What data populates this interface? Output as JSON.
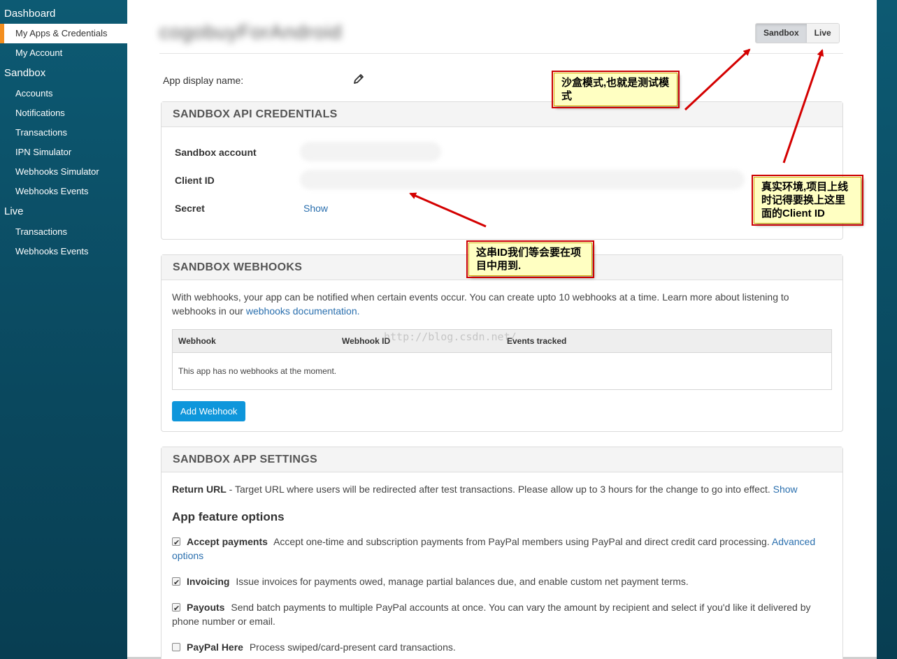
{
  "sidebar": {
    "groups": [
      {
        "label": "Dashboard",
        "items": [
          {
            "label": "My Apps & Credentials",
            "active": true
          },
          {
            "label": "My Account"
          }
        ]
      },
      {
        "label": "Sandbox",
        "items": [
          {
            "label": "Accounts"
          },
          {
            "label": "Notifications"
          },
          {
            "label": "Transactions"
          },
          {
            "label": "IPN Simulator"
          },
          {
            "label": "Webhooks Simulator"
          },
          {
            "label": "Webhooks Events"
          }
        ]
      },
      {
        "label": "Live",
        "items": [
          {
            "label": "Transactions"
          },
          {
            "label": "Webhooks Events"
          }
        ]
      }
    ]
  },
  "header": {
    "app_name": "cogobuyForAndroid",
    "env_toggle": {
      "sandbox": "Sandbox",
      "live": "Live",
      "selected": "Sandbox"
    }
  },
  "app_display_name_label": "App display name:",
  "credentials": {
    "title": "SANDBOX API CREDENTIALS",
    "sandbox_account_label": "Sandbox account",
    "client_id_label": "Client ID",
    "secret_label": "Secret",
    "secret_action": "Show"
  },
  "webhooks": {
    "title": "SANDBOX WEBHOOKS",
    "description": "With webhooks, your app can be notified when certain events occur. You can create upto 10 webhooks at a time. Learn more about listening to webhooks in our ",
    "doc_link": "webhooks documentation.",
    "columns": [
      "Webhook",
      "Webhook ID",
      "Events tracked"
    ],
    "empty_message": "This app has no webhooks at the moment.",
    "add_button": "Add Webhook",
    "watermark": "http://blog.csdn.net/"
  },
  "app_settings": {
    "title": "SANDBOX APP SETTINGS",
    "return_url_label": "Return URL",
    "return_url_text": " - Target URL where users will be redirected after test transactions. Please allow up to 3 hours for the change to go into effect. ",
    "return_url_action": "Show",
    "features_heading": "App feature options",
    "features": [
      {
        "name": "Accept payments",
        "desc": "Accept one-time and subscription payments from PayPal members using PayPal and direct credit card processing. ",
        "link": "Advanced options",
        "checked": true
      },
      {
        "name": "Invoicing",
        "desc": "Issue invoices for payments owed, manage partial balances due, and enable custom net payment terms.",
        "checked": true
      },
      {
        "name": "Payouts",
        "desc": "Send batch payments to multiple PayPal accounts at once. You can vary the amount by recipient and select if you'd like it delivered by phone number or email.",
        "checked": true
      },
      {
        "name": "PayPal Here",
        "desc": "Process swiped/card-present card transactions.",
        "checked": false
      }
    ]
  },
  "annotations": {
    "sandbox_note": "沙盒模式,也就是测试模式",
    "client_id_note": "这串ID我们等会要在项目中用到.",
    "live_note": "真实环境,项目上线时记得要换上这里面的Client ID"
  },
  "colors": {
    "sidebar_bg": "#0b4c63",
    "active_marker": "#f38e1e",
    "link": "#2a6fae",
    "primary_button": "#0e96db",
    "annotation_arrow": "#d40000",
    "annotation_bg": "#ffffc2"
  }
}
